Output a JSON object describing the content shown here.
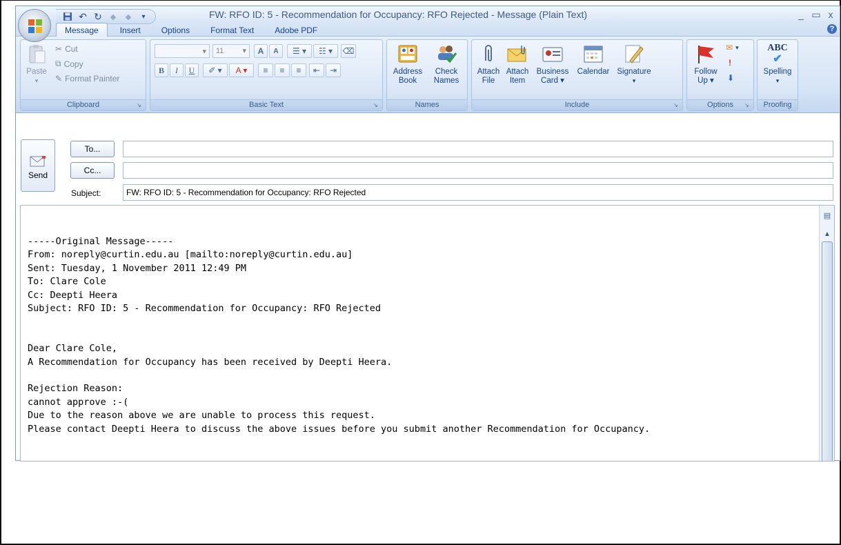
{
  "window": {
    "title": "FW: RFO ID: 5 - Recommendation for Occupancy: RFO Rejected - Message (Plain Text)",
    "controls": {
      "minimize": "_",
      "maximize": "▭",
      "close": "x"
    }
  },
  "quick_access": {
    "more": "▾"
  },
  "tabs": [
    {
      "label": "Message",
      "active": true
    },
    {
      "label": "Insert"
    },
    {
      "label": "Options"
    },
    {
      "label": "Format Text"
    },
    {
      "label": "Adobe PDF"
    }
  ],
  "help": "?",
  "ribbon": {
    "clipboard": {
      "group_label": "Clipboard",
      "paste": "Paste",
      "cut": "Cut",
      "copy": "Copy",
      "format_painter": "Format Painter"
    },
    "basic_text": {
      "group_label": "Basic Text",
      "font_size": "11",
      "bold": "B",
      "italic": "I",
      "underline": "U",
      "grow": "A",
      "shrink": "A"
    },
    "names": {
      "group_label": "Names",
      "address_book": [
        "Address",
        "Book"
      ],
      "check_names": [
        "Check",
        "Names"
      ]
    },
    "include": {
      "group_label": "Include",
      "attach_file": [
        "Attach",
        "File"
      ],
      "attach_item": [
        "Attach",
        "Item"
      ],
      "business_card": [
        "Business",
        "Card ▾"
      ],
      "calendar": "Calendar",
      "signature": "Signature"
    },
    "options": {
      "group_label": "Options",
      "follow_up": [
        "Follow",
        "Up ▾"
      ]
    },
    "proofing": {
      "group_label": "Proofing",
      "spelling": "Spelling",
      "abc": "ABC"
    }
  },
  "compose": {
    "send_label": "Send",
    "to_button": "To...",
    "cc_button": "Cc...",
    "to_value": "",
    "cc_value": "",
    "subject_label": "Subject:",
    "subject_value": "FW: RFO ID: 5 - Recommendation for Occupancy: RFO Rejected"
  },
  "body_lines": [
    "-----Original Message-----",
    "From: noreply@curtin.edu.au [mailto:noreply@curtin.edu.au]",
    "Sent: Tuesday, 1 November 2011 12:49 PM",
    "To: Clare Cole",
    "Cc: Deepti Heera",
    "Subject: RFO ID: 5 - Recommendation for Occupancy: RFO Rejected",
    "",
    "",
    "Dear Clare Cole,",
    "A Recommendation for Occupancy has been received by Deepti Heera.",
    "",
    "Rejection Reason:",
    "cannot approve :-(",
    "Due to the reason above we are unable to process this request.",
    "Please contact Deepti Heera to discuss the above issues before you submit another Recommendation for Occupancy."
  ]
}
